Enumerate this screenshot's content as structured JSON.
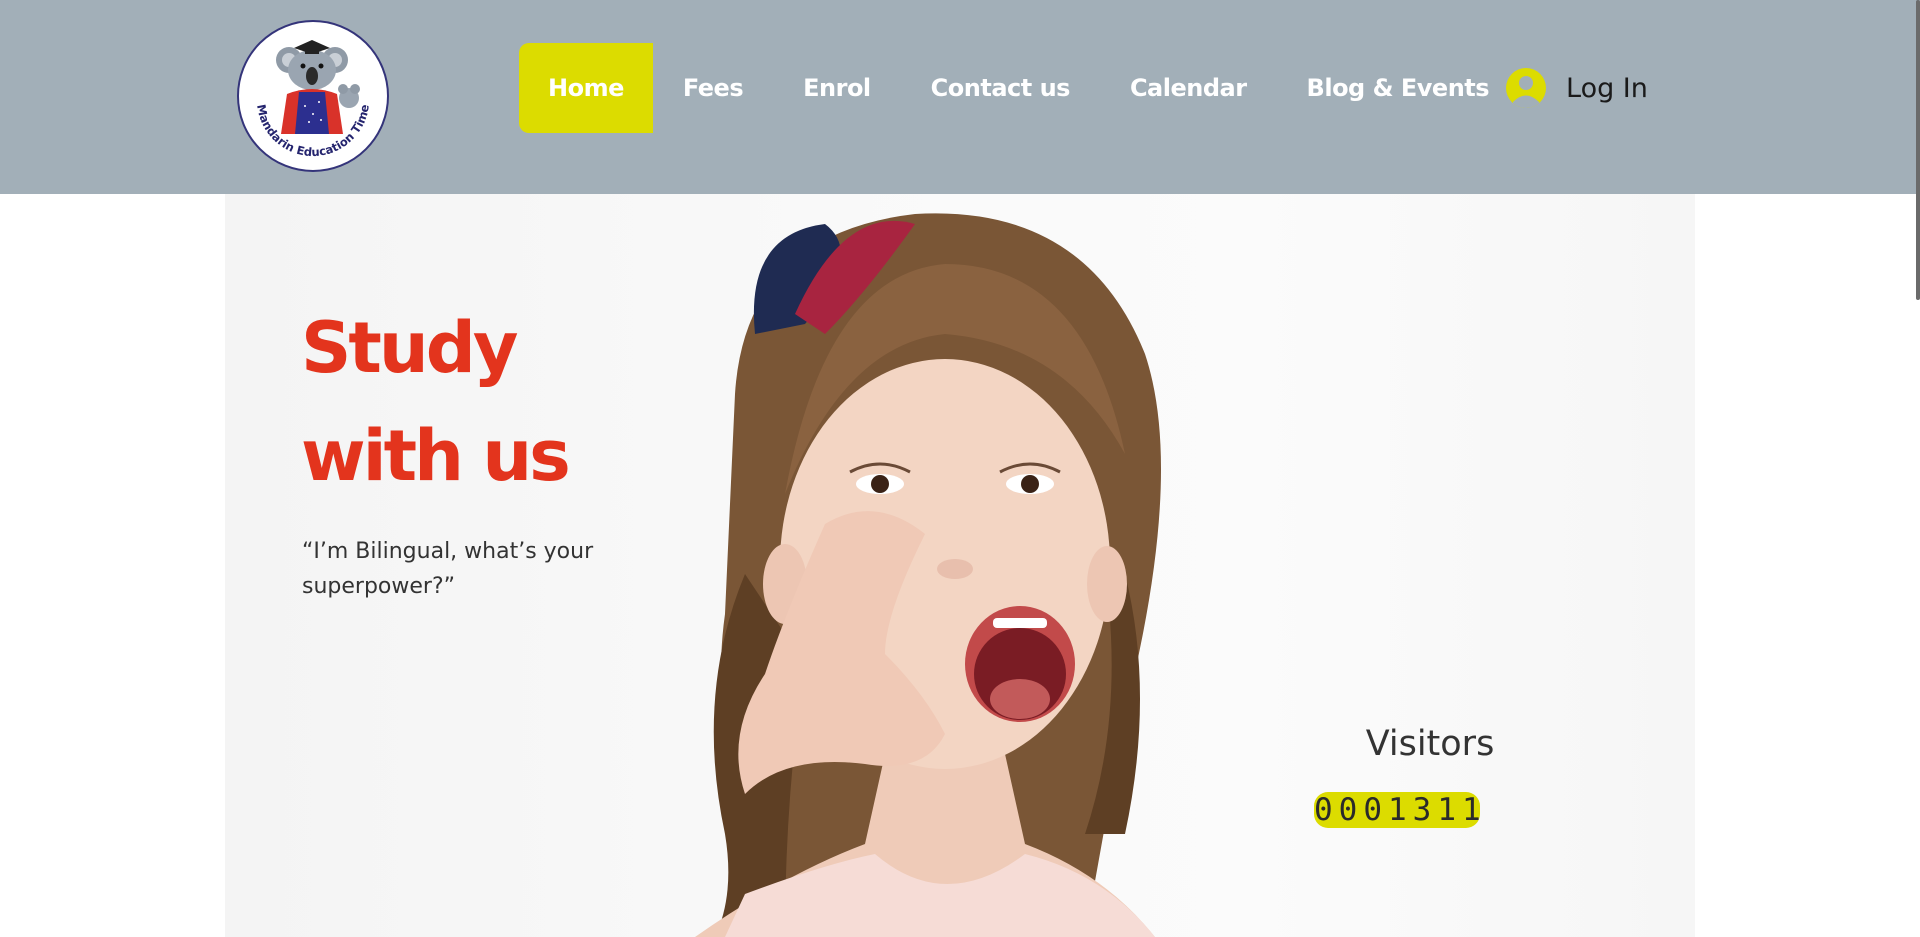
{
  "header": {
    "logo": {
      "text": "Mandarin Education Time",
      "icon": "koala-graduate-logo-icon"
    },
    "nav": [
      {
        "label": "Home",
        "active": true
      },
      {
        "label": "Fees",
        "active": false
      },
      {
        "label": "Enrol",
        "active": false
      },
      {
        "label": "Contact us",
        "active": false
      },
      {
        "label": "Calendar",
        "active": false
      },
      {
        "label": "Blog & Events",
        "active": false
      }
    ],
    "login_label": "Log In",
    "login_icon": "user-avatar-icon"
  },
  "hero": {
    "title_line1": "Study",
    "title_line2": "with us",
    "quote": "“I’m Bilingual, what’s your superpower?”",
    "visitors_label": "Visitors",
    "visitors_count": "0001311"
  },
  "colors": {
    "header_bg": "#a2afb8",
    "accent": "#dcdc00",
    "title_red": "#e3341d"
  }
}
